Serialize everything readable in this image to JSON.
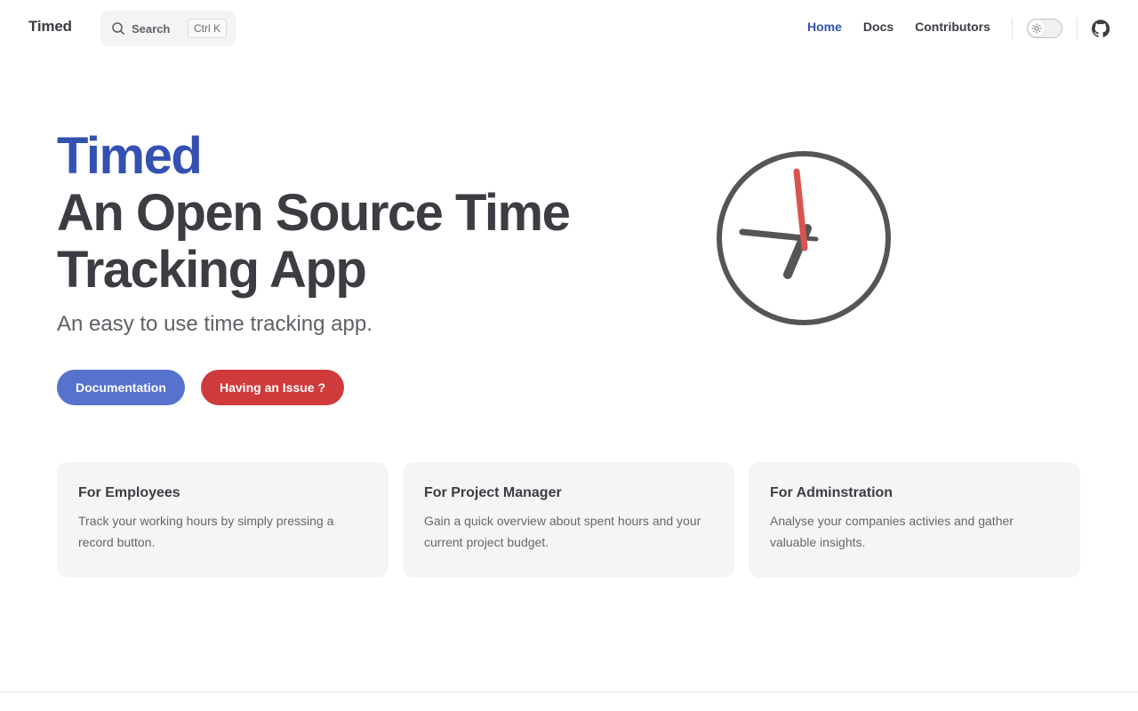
{
  "nav": {
    "brand": "Timed",
    "search_label": "Search",
    "search_shortcut": "Ctrl K",
    "links": [
      {
        "label": "Home",
        "active": true
      },
      {
        "label": "Docs",
        "active": false
      },
      {
        "label": "Contributors",
        "active": false
      }
    ],
    "theme_icon": "sun-icon",
    "github_icon": "github-icon"
  },
  "hero": {
    "name": "Timed",
    "text": "An Open Source Time Tracking App",
    "tagline": "An easy to use time tracking app.",
    "actions": [
      {
        "label": "Documentation",
        "color": "#5672cd"
      },
      {
        "label": "Having an Issue ?",
        "color": "#cf3b3b"
      }
    ],
    "image_icon": "clock-icon"
  },
  "features": [
    {
      "title": "For Employees",
      "details": "Track your working hours by simply pressing a record button."
    },
    {
      "title": "For Project Manager",
      "details": "Gain a quick overview about spent hours and your current project budget."
    },
    {
      "title": "For Adminstration",
      "details": "Analyse your companies activies and gather valuable insights."
    }
  ],
  "colors": {
    "brand": "#3451b2",
    "text": "#3c3c43",
    "clock_face": "#555555",
    "clock_second_hand": "#d9534f"
  }
}
